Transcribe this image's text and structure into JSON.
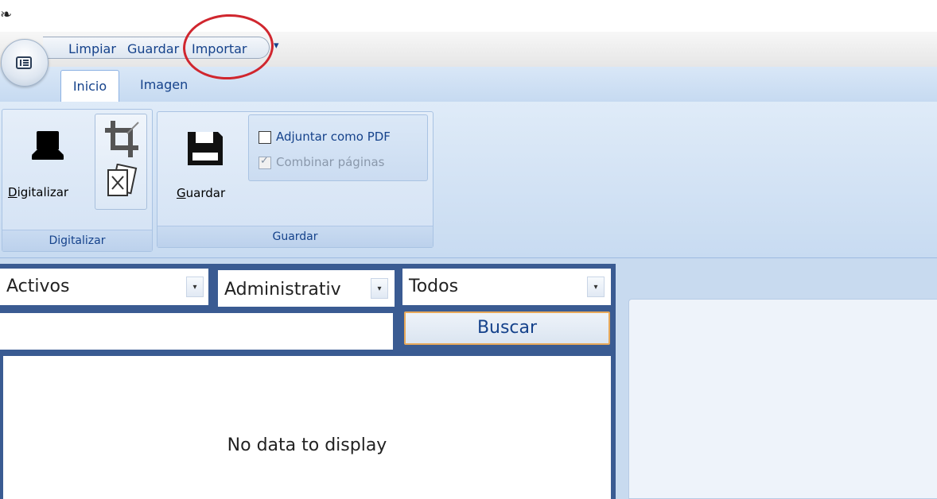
{
  "titlebar": {
    "app_icon": "app-logo-icon",
    "app_glyph": "❧"
  },
  "quick_access": {
    "items": [
      "Limpiar",
      "Guardar",
      "Importar"
    ],
    "dropdown_glyph": "▾"
  },
  "tabs": {
    "active": "Inicio",
    "inactive": "Imagen"
  },
  "ribbon": {
    "digitalizar": {
      "scan_label_prefix": "D",
      "scan_label_rest": "igitalizar",
      "group_label": "Digitalizar"
    },
    "guardar": {
      "save_label_prefix": "G",
      "save_label_rest": "uardar",
      "pdf_label": "Adjuntar como PDF",
      "pdf_checked": false,
      "combine_label": "Combinar páginas",
      "combine_checked": true,
      "group_label": "Guardar"
    }
  },
  "filters": {
    "status": "Activos",
    "department": "Administrativ",
    "scope": "Todos",
    "arrow_glyph": "▾"
  },
  "search": {
    "value": "",
    "button_label": "Buscar"
  },
  "grid": {
    "empty_text": "No data to display"
  },
  "colors": {
    "accent": "#15428b",
    "annotation": "#d0262e",
    "panel_border": "#3a5b92"
  }
}
